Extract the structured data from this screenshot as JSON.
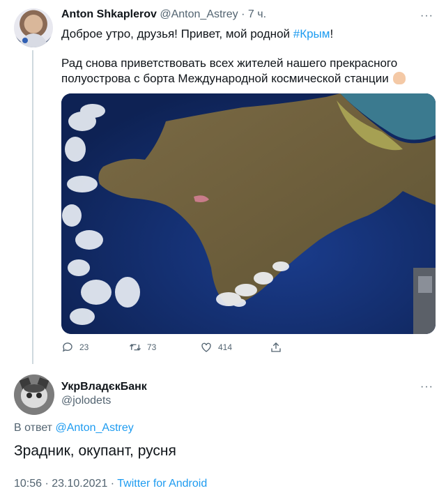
{
  "tweet1": {
    "author_name": "Anton Shkaplerov",
    "author_handle": "@Anton_Astrey",
    "separator": "·",
    "time": "7 ч.",
    "more": "···",
    "text_line1_prefix": "Доброе утро, друзья! Привет, мой родной ",
    "hashtag": "#Крым",
    "text_line1_suffix": "!",
    "text_line2": "Рад снова приветствовать всех жителей нашего прекрасного",
    "text_line3": "полуострова с борта Международной космической станции",
    "counts": {
      "replies": "23",
      "retweets": "73",
      "likes": "414"
    },
    "icons": [
      "reply-icon",
      "retweet-icon",
      "like-icon",
      "share-icon"
    ]
  },
  "tweet2": {
    "author_name": "УкрВладєкБанк",
    "author_handle": "@jolodets",
    "more": "···",
    "reply_prefix": "В ответ",
    "reply_mention": "@Anton_Astrey",
    "text": "Зрадник, окупант, русня",
    "timestamp": "10:56 · 23.10.2021 · ",
    "source": "Twitter for Android"
  },
  "colors": {
    "accent": "#1d9bf0",
    "secondary_text": "#536471",
    "primary_text": "#0f1419"
  }
}
